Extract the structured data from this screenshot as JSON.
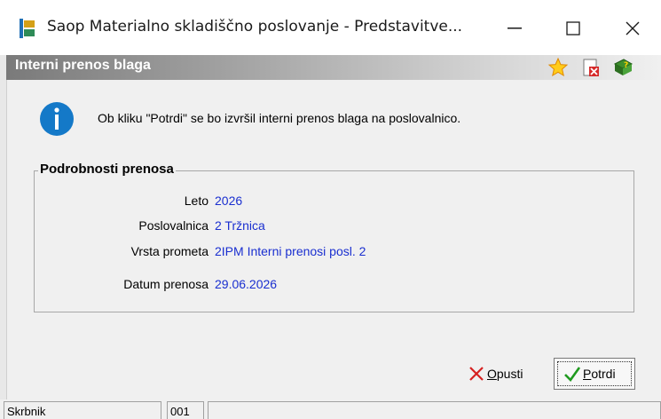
{
  "window": {
    "title": "Saop Materialno skladiščno poslovanje - Predstavitve...",
    "minimize_symbol": "—",
    "maximize_symbol": "☐",
    "close_symbol": "✕"
  },
  "dialog": {
    "title": "Interni prenos blaga",
    "header_icons": [
      "star-icon",
      "delete-document-icon",
      "help-book-icon"
    ],
    "info_icon": "info-icon",
    "message": "Ob kliku \"Potrdi\" se bo izvršil interni prenos blaga na poslovalnico."
  },
  "details": {
    "legend": "Podrobnosti prenosa",
    "rows": [
      {
        "label": "Leto",
        "value": "2026"
      },
      {
        "label": "Poslovalnica",
        "value": "2 Tržnica"
      },
      {
        "label": "Vrsta prometa",
        "value": "2IPM Interni prenosi posl. 2"
      },
      {
        "label": "Datum prenosa",
        "value": "29.06.2026"
      }
    ]
  },
  "buttons": {
    "cancel": {
      "label_first": "O",
      "label_rest": "pusti",
      "icon": "x-icon"
    },
    "confirm": {
      "label_first": "P",
      "label_rest": "otrdi",
      "icon": "checkmark-icon"
    }
  },
  "status": {
    "user": "Skrbnik",
    "code": "001",
    "extra": ""
  },
  "colors": {
    "value_text": "#1a2fd0",
    "info_blue": "#1479c8",
    "header_gradient_start": "#7a7a7a"
  }
}
